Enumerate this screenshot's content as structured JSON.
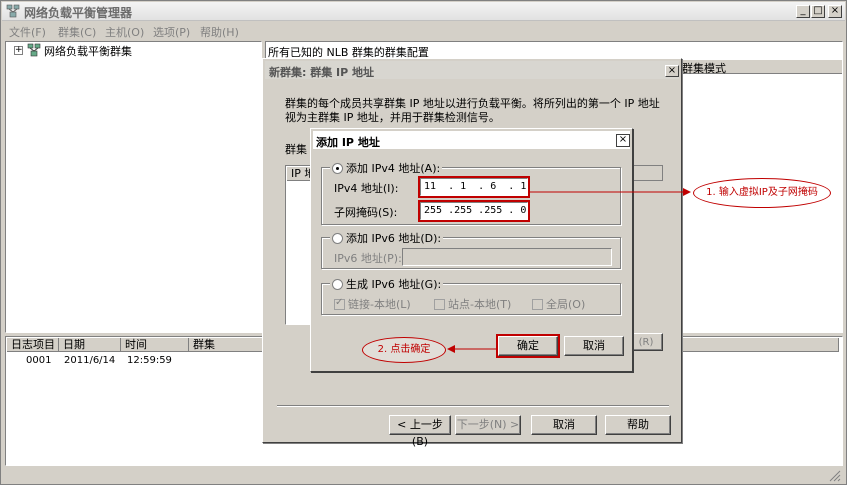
{
  "window": {
    "title": "网络负载平衡管理器",
    "buttons": {
      "minimize": "_",
      "maximize": "□",
      "close": "×"
    }
  },
  "menu": [
    "文件(F)",
    "群集(C)",
    "主机(O)",
    "选项(P)",
    "帮助(H)"
  ],
  "tree": {
    "expander": "+",
    "root_label": "网络负载平衡群集"
  },
  "right_pane": {
    "header": "所有已知的 NLB 群集的群集配置",
    "column_mode": "群集模式"
  },
  "log": {
    "columns": [
      "日志项目",
      "日期",
      "时间",
      "群集"
    ],
    "rows": [
      {
        "id": "0001",
        "date": "2011/6/14",
        "time": "12:59:59",
        "cluster": ""
      }
    ]
  },
  "dialog_new_cluster": {
    "title": "新群集:   群集 IP 地址",
    "close": "×",
    "description": "群集的每个成员共享群集 IP 地址以进行负载平衡。将所列出的第一个 IP 地址视为主群集 IP 地址，并用于群集检测信号。",
    "group_label": "群集",
    "list_header": "IP 地",
    "side_button": "(R)",
    "buttons": {
      "back": "< 上一步(B)",
      "next": "下一步(N) >",
      "cancel": "取消",
      "help": "帮助"
    }
  },
  "dialog_add_ip": {
    "title": "添加 IP 地址",
    "close": "×",
    "ipv4_group": {
      "radio_label": "添加 IPv4 地址(A):",
      "ip_label": "IPv4 地址(I):",
      "ip_value": "11  . 1  . 6  . 1",
      "mask_label": "子网掩码(S):",
      "mask_value": "255 .255 .255 . 0"
    },
    "ipv6_group": {
      "radio_label": "添加 IPv6 地址(D):",
      "addr_label": "IPv6 地址(P):"
    },
    "gen_group": {
      "radio_label": "生成 IPv6 地址(G):",
      "check_link": "链接-本地(L)",
      "check_site": "站点-本地(T)",
      "check_global": "全局(O)"
    },
    "buttons": {
      "ok": "确定",
      "cancel": "取消"
    }
  },
  "annotations": {
    "note1": "1. 输入虚拟IP及子网掩码",
    "note2": "2. 点击确定"
  },
  "colors": {
    "annotation": "#c00000",
    "selection": "#0a246a"
  }
}
